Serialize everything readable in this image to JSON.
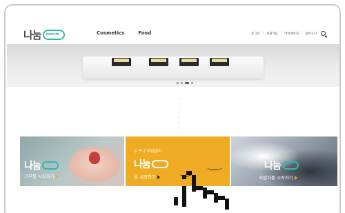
{
  "header": {
    "logo_text": "나눔",
    "logo_badge": "nanum",
    "nav": [
      "Cosmetics",
      "Food"
    ],
    "util_links": [
      "로그인",
      "회원가입",
      "마이페이지",
      "장바구니"
    ],
    "util_sep": "|",
    "icons": {
      "search": "search-icon"
    }
  },
  "banner": {
    "slide_count": 4,
    "active_slide": 2
  },
  "cards": [
    {
      "logo": "나눔",
      "subtitle": "기부를 시작하기",
      "tone": "#8fa6aa"
    },
    {
      "title": "누구나 부담없이",
      "logo": "나눔",
      "subtitle": "을 시작하기",
      "tone": "#f0ab24"
    },
    {
      "logo": "나눔",
      "subtitle": "사업자를 시작하기",
      "tone": "#5b6570"
    }
  ],
  "colors": {
    "accent": "#2fb8b0",
    "card_yellow": "#f0ab24"
  },
  "pointer": "pointer-hand-icon"
}
